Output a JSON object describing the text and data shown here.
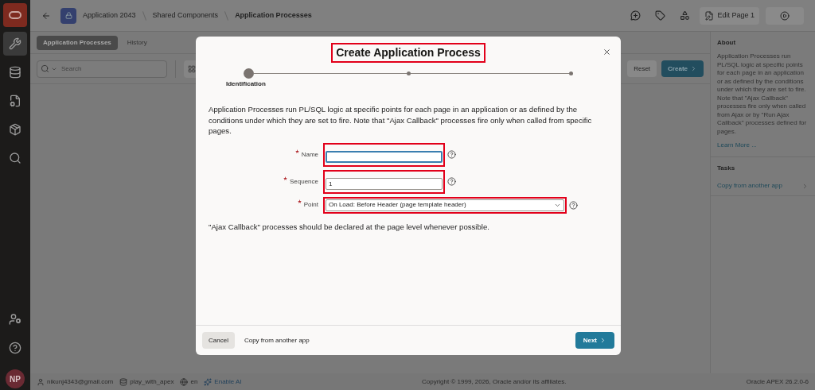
{
  "rail": {
    "items": [
      {
        "kind": "tools",
        "selected": true
      },
      {
        "kind": "database",
        "selected": false
      },
      {
        "kind": "page",
        "selected": false
      },
      {
        "kind": "box",
        "selected": false
      },
      {
        "kind": "search",
        "selected": false
      }
    ],
    "bottom": [
      {
        "kind": "user"
      },
      {
        "kind": "help"
      }
    ],
    "avatar": "NP"
  },
  "breadcrumb": [
    "Application 2043",
    "Shared Components",
    "Application Processes"
  ],
  "header_buttons": {
    "edit": "Edit Page 1"
  },
  "tabs": [
    {
      "label": "Application Processes",
      "selected": true
    },
    {
      "label": "History",
      "selected": false
    }
  ],
  "toolbar": {
    "search_placeholder": "Search",
    "reset": "Reset",
    "create": "Create"
  },
  "about": {
    "title": "About",
    "text": "Application Processes run PL/SQL logic at specific points for each page in an application or as defined by the conditions under which they are set to fire. Note that \"Ajax Callback\" processes fire only when called from Ajax or by \"Run Ajax Callback\" processes defined for pages.",
    "link": "Learn More ..."
  },
  "tasks": {
    "title": "Tasks",
    "items": [
      "Copy from another app"
    ]
  },
  "status_bar": {
    "user": "nikunj4343@gmail.com",
    "workspace": "play_with_apex",
    "language": "en",
    "ai": "Enable AI",
    "copyright": "Copyright © 1999, 2026, Oracle and/or its affiliates.",
    "version": "Oracle APEX 26.2.0-6"
  },
  "dialog": {
    "title": "Create Application Process",
    "steps": [
      {
        "label": "Identification",
        "selected": true
      },
      {
        "selected": false
      },
      {
        "selected": false
      }
    ],
    "intro": "Application Processes run PL/SQL logic at specific points for each page in an application or as defined by the conditions under which they are set to fire. Note that \"Ajax Callback\" processes fire only when called from specific pages.",
    "fields": [
      {
        "kind": "text",
        "label": "Name",
        "required": true,
        "focused": true
      },
      {
        "kind": "text",
        "label": "Sequence",
        "required": true,
        "focused": false,
        "value": "1"
      },
      {
        "kind": "select",
        "label": "Point",
        "required": true,
        "focused": false,
        "value": "On Load: Before Header (page template header)"
      }
    ],
    "note": "\"Ajax Callback\" processes should be declared at the page level whenever possible.",
    "buttons": {
      "cancel": "Cancel",
      "copy": "Copy from another app",
      "next": "Next"
    }
  }
}
